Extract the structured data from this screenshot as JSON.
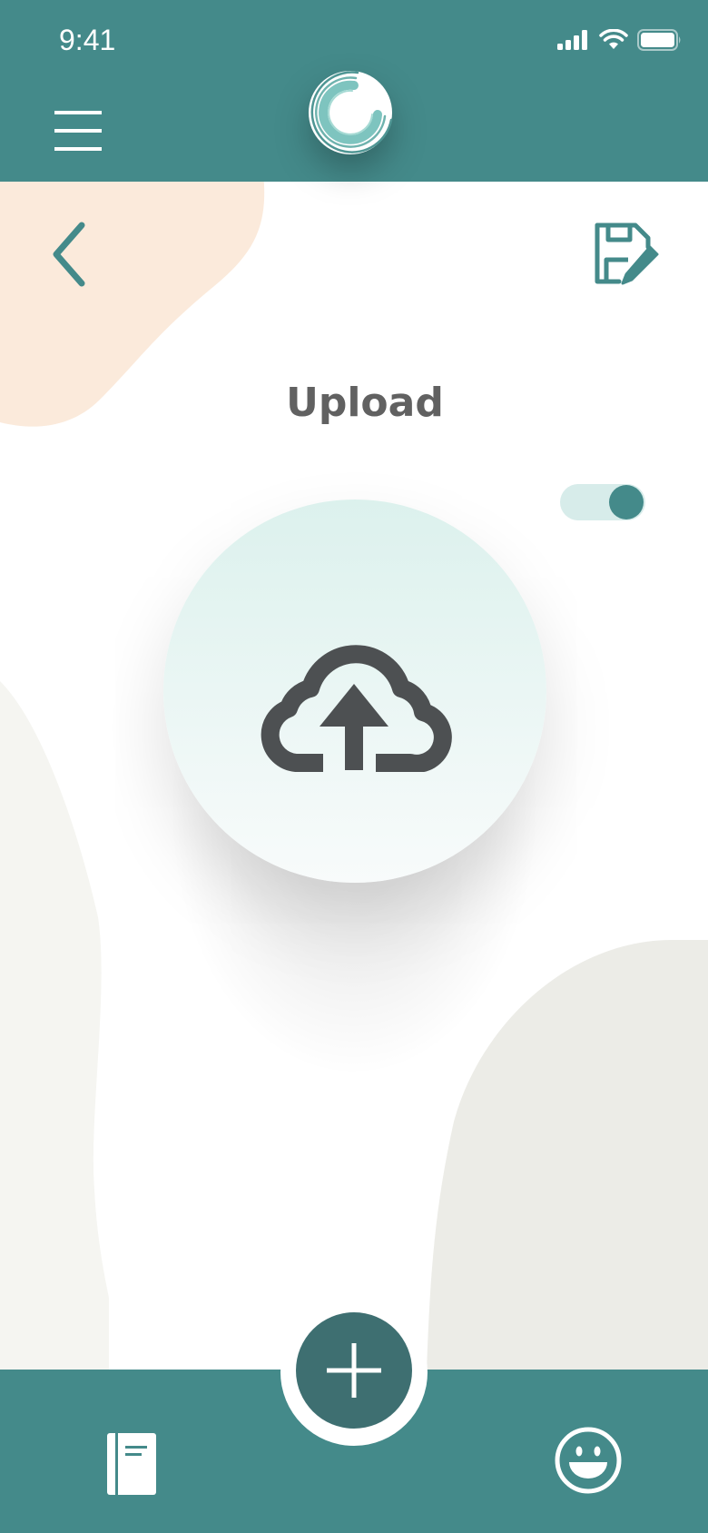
{
  "status_bar": {
    "time": "9:41",
    "signal_icon": "cellular-signal-icon",
    "wifi_icon": "wifi-icon",
    "battery_icon": "battery-icon"
  },
  "header": {
    "menu_icon": "hamburger-menu-icon",
    "logo_icon": "app-logo-icon"
  },
  "toolbar": {
    "back_icon": "chevron-left-icon",
    "save_icon": "save-edit-icon"
  },
  "main": {
    "title": "Upload",
    "toggle_on": true,
    "upload_icon": "cloud-upload-icon"
  },
  "bottom_nav": {
    "journal_icon": "journal-icon",
    "add_icon": "plus-icon",
    "mood_icon": "smiley-icon"
  },
  "colors": {
    "primary": "#448a8a",
    "fab": "#3e6f71",
    "title": "#616161",
    "toggle_track": "#d7ecea",
    "upload_gradient_top": "#dcf1ed",
    "icon_dark": "#4d5052",
    "blob_peach": "#fbeadb",
    "blob_gray": "#ececE7"
  }
}
